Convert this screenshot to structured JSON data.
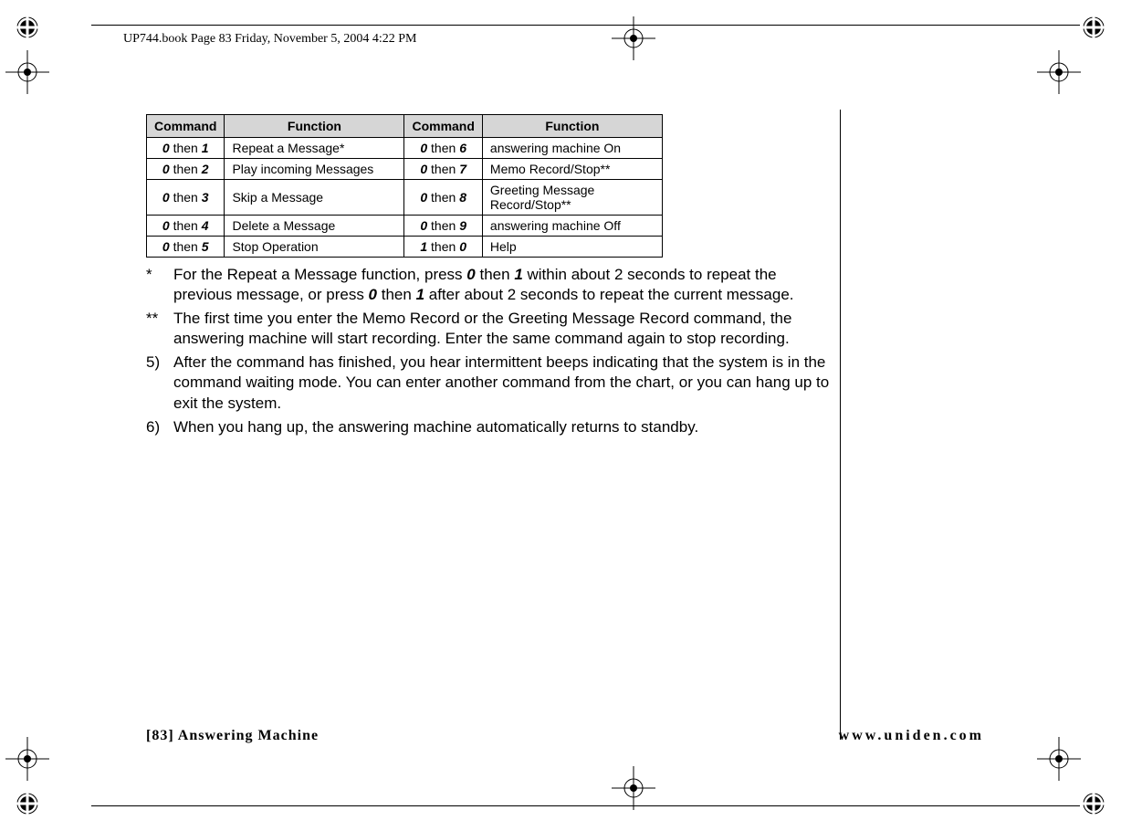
{
  "header": "UP744.book  Page 83  Friday, November 5, 2004  4:22 PM",
  "table": {
    "headers": [
      "Command",
      "Function",
      "Command",
      "Function"
    ],
    "rows": [
      {
        "c1a": "0",
        "c1t": " then ",
        "c1b": "1",
        "f1": "Repeat a Message*",
        "c2a": "0",
        "c2t": " then ",
        "c2b": "6",
        "f2": "answering machine On"
      },
      {
        "c1a": "0",
        "c1t": " then ",
        "c1b": "2",
        "f1": "Play incoming Messages",
        "c2a": "0",
        "c2t": " then ",
        "c2b": "7",
        "f2": "Memo Record/Stop**"
      },
      {
        "c1a": "0",
        "c1t": " then ",
        "c1b": "3",
        "f1": "Skip a Message",
        "c2a": "0",
        "c2t": " then ",
        "c2b": "8",
        "f2": "Greeting Message Record/Stop**"
      },
      {
        "c1a": "0",
        "c1t": " then ",
        "c1b": "4",
        "f1": "Delete a Message",
        "c2a": "0",
        "c2t": " then ",
        "c2b": "9",
        "f2": "answering machine Off"
      },
      {
        "c1a": "0",
        "c1t": " then ",
        "c1b": "5",
        "f1": "Stop Operation",
        "c2a": "1",
        "c2t": " then ",
        "c2b": "0",
        "f2": "Help"
      }
    ]
  },
  "notes": {
    "n1_marker": "*",
    "n1_a": "For the Repeat a Message function, press ",
    "n1_b": "0",
    "n1_c": " then ",
    "n1_d": "1",
    "n1_e": " within about 2 seconds to repeat the previous message, or press ",
    "n1_f": "0",
    "n1_g": " then ",
    "n1_h": "1",
    "n1_i": " after about 2 seconds to repeat the current message.",
    "n2_marker": "**",
    "n2": "The first time you enter the Memo Record or the Greeting Message Record command, the answering machine will start recording. Enter the same command again to stop recording.",
    "n3_marker": "5)",
    "n3": "After the command has finished, you hear intermittent beeps indicating that the system is in the command waiting mode. You can enter another command from the chart, or you can hang up to exit the system.",
    "n4_marker": "6)",
    "n4": "When you hang up, the answering machine automatically returns to standby."
  },
  "footer": {
    "left": "[83] Answering Machine",
    "right": "www.uniden.com"
  }
}
